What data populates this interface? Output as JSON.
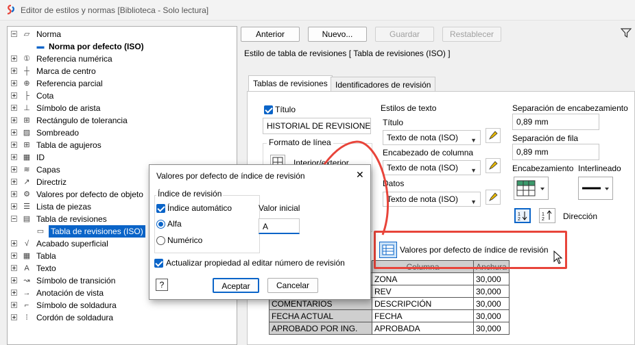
{
  "window": {
    "title": "Editor de estilos y normas [Biblioteca - Solo lectura]"
  },
  "tree": {
    "items": [
      {
        "label": "Norma",
        "icon": "norma-icon",
        "type": "open"
      },
      {
        "label": "Norma por defecto (ISO)",
        "icon": "norm-default-icon",
        "type": "child-bold"
      },
      {
        "label": "Referencia numérica",
        "icon": "balloon-icon",
        "type": "plus"
      },
      {
        "label": "Marca de centro",
        "icon": "centermark-icon",
        "type": "plus"
      },
      {
        "label": "Referencia parcial",
        "icon": "datum-icon",
        "type": "plus"
      },
      {
        "label": "Cota",
        "icon": "dimension-icon",
        "type": "plus"
      },
      {
        "label": "Símbolo de arista",
        "icon": "edge-symbol-icon",
        "type": "plus"
      },
      {
        "label": "Rectángulo de tolerancia",
        "icon": "tolerance-icon",
        "type": "plus"
      },
      {
        "label": "Sombreado",
        "icon": "hatch-icon",
        "type": "plus"
      },
      {
        "label": "Tabla de agujeros",
        "icon": "hole-table-icon",
        "type": "plus"
      },
      {
        "label": "ID",
        "icon": "id-icon",
        "type": "plus"
      },
      {
        "label": "Capas",
        "icon": "layers-icon",
        "type": "plus"
      },
      {
        "label": "Directriz",
        "icon": "leader-icon",
        "type": "plus"
      },
      {
        "label": "Valores por defecto de objeto",
        "icon": "object-defaults-icon",
        "type": "plus"
      },
      {
        "label": "Lista de piezas",
        "icon": "parts-list-icon",
        "type": "plus"
      },
      {
        "label": "Tabla de revisiones",
        "icon": "revision-table-icon",
        "type": "open"
      },
      {
        "label": "Tabla de revisiones (ISO)",
        "icon": "revision-iso-icon",
        "type": "child-selected"
      },
      {
        "label": "Acabado superficial",
        "icon": "surface-icon",
        "type": "plus"
      },
      {
        "label": "Tabla",
        "icon": "table-icon",
        "type": "plus"
      },
      {
        "label": "Texto",
        "icon": "text-icon",
        "type": "plus"
      },
      {
        "label": "Símbolo de transición",
        "icon": "transition-icon",
        "type": "plus"
      },
      {
        "label": "Anotación de vista",
        "icon": "view-annotation-icon",
        "type": "plus"
      },
      {
        "label": "Símbolo de soldadura",
        "icon": "weld-symbol-icon",
        "type": "plus"
      },
      {
        "label": "Cordón de soldadura",
        "icon": "weld-bead-icon",
        "type": "plus"
      }
    ]
  },
  "toolbar": {
    "back": "Anterior",
    "new": "Nuevo...",
    "save": "Guardar",
    "reset": "Restablecer"
  },
  "panel": {
    "heading": "Estilo de tabla de revisiones [ Tabla de revisiones (ISO) ]",
    "tabs": [
      "Tablas de revisiones",
      "Identificadores de revisión"
    ],
    "title_check": "Título",
    "title_value": "HISTORIAL DE REVISIONES",
    "line_format": "Formato de línea",
    "line_format_btn": "Interior/exterior",
    "text_styles": "Estilos de texto",
    "title_label": "Título",
    "title_style": "Texto de nota (ISO)",
    "col_header_label": "Encabezado de columna",
    "col_header_style": "Texto de nota (ISO)",
    "data_label": "Datos",
    "data_style": "Texto de nota (ISO)",
    "header_sep_label": "Separación de encabezamiento",
    "header_sep_value": "0,89 mm",
    "row_sep_label": "Separación de fila",
    "row_sep_value": "0,89 mm",
    "header_label": "Encabezamiento",
    "spacing_label": "Interlineado",
    "direction_label": "Dirección",
    "defaults_btn": "Valores por defecto de índice de revisión",
    "table_header": [
      "Columna",
      "Anchura"
    ],
    "rows": [
      {
        "prop": "",
        "col": "ZONA",
        "width": "30,000"
      },
      {
        "prop": "",
        "col": "REV",
        "width": "30,000"
      },
      {
        "prop": "COMENTARIOS",
        "col": "DESCRIPCIÓN",
        "width": "30,000"
      },
      {
        "prop": "FECHA ACTUAL",
        "col": "FECHA",
        "width": "30,000"
      },
      {
        "prop": "APROBADO POR ING.",
        "col": "APROBADA",
        "width": "30,000"
      }
    ]
  },
  "dialog": {
    "title": "Valores por defecto de índice de revisión",
    "close": "✕",
    "group": "Índice de revisión",
    "auto_index": "Índice automático",
    "initial_value_label": "Valor inicial",
    "initial_value": "A",
    "alpha": "Alfa",
    "numeric": "Numérico",
    "update_prop": "Actualizar propiedad al editar número de revisión",
    "help": "?",
    "ok": "Aceptar",
    "cancel": "Cancelar"
  },
  "colors": {
    "accent": "#0a64c8",
    "highlight": "#e8443a"
  }
}
